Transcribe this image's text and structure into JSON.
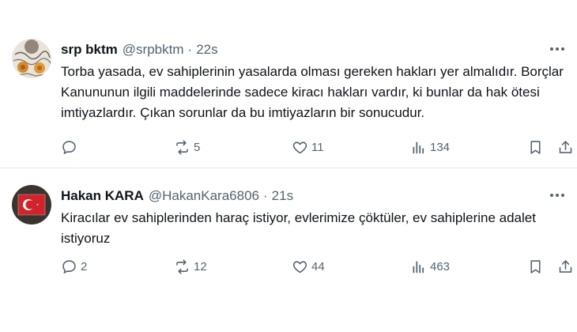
{
  "posts": [
    {
      "author": "srp bktm",
      "handle": "@srpbktm",
      "separator": "·",
      "time": "22s",
      "text": "Torba yasada, ev sahiplerinin yasalarda olması gereken hakları yer almalıdır. Borçlar Kanununun ilgili maddelerinde sadece kiracı hakları vardır, ki bunlar da hak ötesi imtiyazlardır. Çıkan sorunlar da bu imtiyazların bir sonucudur.",
      "replies": "",
      "reposts": "5",
      "likes": "11",
      "views": "134",
      "avatar": "sketch-artwork-avatar"
    },
    {
      "author": "Hakan KARA",
      "handle": "@HakanKara6806",
      "separator": "·",
      "time": "21s",
      "text": "Kiracılar ev sahiplerinden haraç istiyor, evlerimize çöktüler, ev sahiplerine adalet istiyoruz",
      "replies": "2",
      "reposts": "12",
      "likes": "44",
      "views": "463",
      "avatar": "turkish-flag-avatar"
    }
  ],
  "icons": {
    "more": "more-dots-icon",
    "reply": "reply-bubble-icon",
    "repost": "repost-arrows-icon",
    "like": "heart-icon",
    "views": "bar-chart-icon",
    "bookmark": "bookmark-icon",
    "share": "share-upload-icon"
  },
  "colors": {
    "text": "#0f1419",
    "secondary": "#536471",
    "divider": "#e4e7ea",
    "flag_red": "#d2232a"
  }
}
